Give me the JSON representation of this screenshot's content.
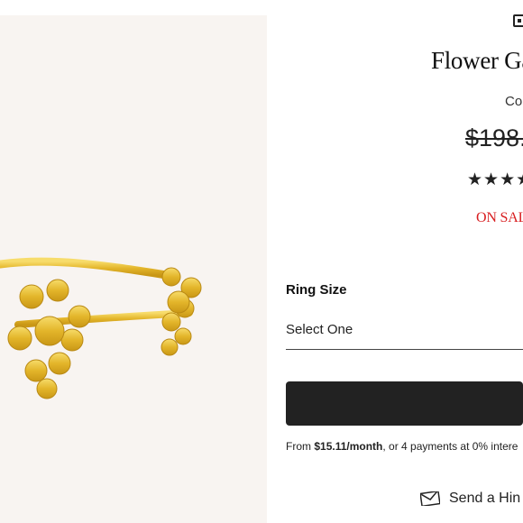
{
  "product": {
    "title": "Flower Ga",
    "subtitle": "Co",
    "price": "$198.",
    "stars": "★★★★",
    "sale_label": "ON SAL",
    "image_description_icon": "gold-flower-ring"
  },
  "options": {
    "ring_size_label": "Ring Size",
    "ring_size_value": "Select One"
  },
  "payment": {
    "prefix": "From ",
    "amount": "$15.11/month",
    "suffix": ", or 4 payments at 0% intere"
  },
  "hint": {
    "label": "Send a Hin",
    "icon": "envelope-icon"
  },
  "colors": {
    "panel_bg": "#f8f4f1",
    "sale_red": "#d81e20",
    "button_bg": "#222222",
    "gold": "#e8c23a"
  }
}
